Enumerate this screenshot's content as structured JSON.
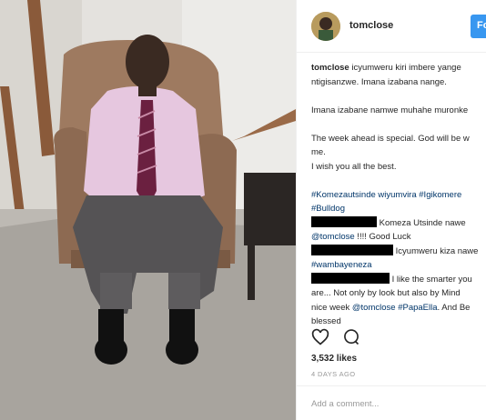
{
  "post": {
    "username": "tomclose",
    "follow_label": "Fo",
    "caption": {
      "username": "tomclose",
      "line1": "icyumweru kiri imbere yange",
      "line2": "ntigisanzwe. Imana izabana nange.",
      "line3": "Imana izabane namwe muhahe muronke",
      "line4": "The week ahead is special. God will be w",
      "line5": "me.",
      "line6": "I wish you all the best.",
      "tags1": "#Komezautsinde wiyumvira #Igikomere",
      "tags2": "#Bulldog"
    },
    "comments": [
      {
        "line1": "Komeza Utsinde nawe",
        "mention": "@tomclose",
        "line2_rest": " !!!! Good Luck"
      },
      {
        "line1": "Icyumweru kiza nawe",
        "tag": "#wambayeneza"
      },
      {
        "line1": "I like the smarter you",
        "line2": "are... Not only by look but also by Mind",
        "line3_pre": "nice week ",
        "mention": "@tomclose",
        "tag": " #PapaElla",
        "line3_post": ". And Be",
        "line4": "blessed"
      }
    ],
    "likes": "3,532 likes",
    "time_ago": "4 DAYS AGO",
    "add_comment_placeholder": "Add a comment..."
  },
  "icons": [
    "heart-icon",
    "comment-icon"
  ],
  "colors": {
    "link": "#003569",
    "follow": "#3897f0",
    "muted": "#999999"
  }
}
